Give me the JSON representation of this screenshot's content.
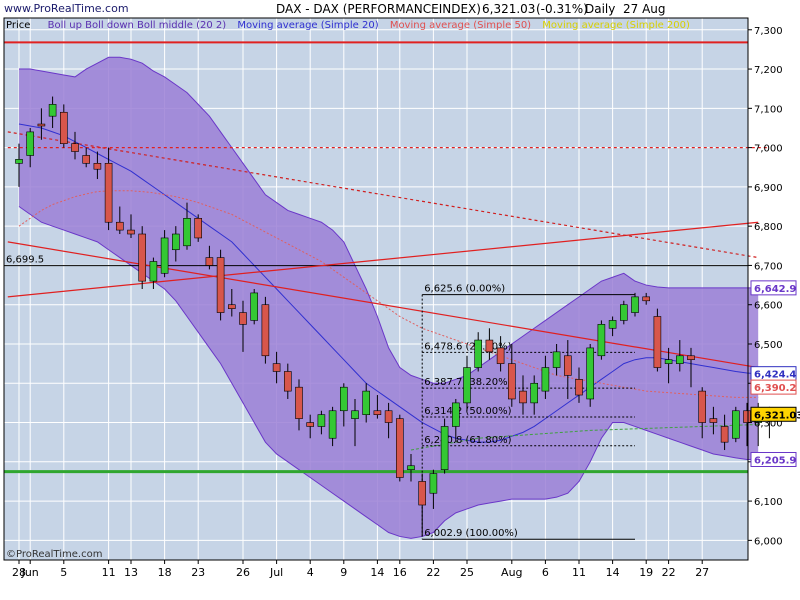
{
  "header": {
    "logo": "www.ProRealTime.com",
    "instrument": "DAX - DAX (PERFORMANCEINDEX)",
    "last": "6,321.03",
    "change": "(-0.31%)",
    "period": "Daily",
    "date": "27 Aug",
    "footer_logo": "©ProRealTime.com"
  },
  "legend": {
    "price": "Price",
    "boll": "Boll up Boll down Boll middle (20 2)",
    "ma20": "Moving average (Simple 20)",
    "ma50": "Moving average (Simple 50)",
    "ma200": "Moving average (Simple 200)"
  },
  "colors": {
    "background": "#c6d4e6",
    "band": "#9b7fd6",
    "band_edge": "#6a37c8",
    "up": "#34c834",
    "down": "#d8564b",
    "red_line": "#e02020",
    "green_line": "#2fa62f"
  },
  "chart_data": {
    "type": "candlestick",
    "ylim": [
      5950,
      7330
    ],
    "yticks": [
      6000,
      6100,
      6200,
      6300,
      6400,
      6500,
      6600,
      6700,
      6800,
      6900,
      7000,
      7100,
      7200,
      7300
    ],
    "ytick_labels": [
      "6,000",
      "6,100",
      "6,200",
      "6,300",
      "6,400",
      "6,500",
      "6,600",
      "6,700",
      "6,800",
      "6,900",
      "7,000",
      "7,100",
      "7,200",
      "7,300"
    ],
    "xticks": [
      {
        "i": 0,
        "label": "28"
      },
      {
        "i": 1,
        "label": "Jun"
      },
      {
        "i": 4,
        "label": "5"
      },
      {
        "i": 8,
        "label": "11"
      },
      {
        "i": 10,
        "label": "13"
      },
      {
        "i": 13,
        "label": "18"
      },
      {
        "i": 16,
        "label": "23"
      },
      {
        "i": 20,
        "label": "26"
      },
      {
        "i": 23,
        "label": "Jul"
      },
      {
        "i": 26,
        "label": "4"
      },
      {
        "i": 29,
        "label": "9"
      },
      {
        "i": 32,
        "label": "14"
      },
      {
        "i": 34,
        "label": "16"
      },
      {
        "i": 37,
        "label": "22"
      },
      {
        "i": 40,
        "label": "25"
      },
      {
        "i": 44,
        "label": "Aug"
      },
      {
        "i": 47,
        "label": "6"
      },
      {
        "i": 50,
        "label": "11"
      },
      {
        "i": 53,
        "label": "14"
      },
      {
        "i": 56,
        "label": "19"
      },
      {
        "i": 58,
        "label": "22"
      },
      {
        "i": 61,
        "label": "27"
      }
    ],
    "candles": [
      {
        "o": 6960,
        "h": 7010,
        "l": 6900,
        "c": 6970
      },
      {
        "o": 6980,
        "h": 7050,
        "l": 6950,
        "c": 7040
      },
      {
        "o": 7060,
        "h": 7100,
        "l": 7020,
        "c": 7055
      },
      {
        "o": 7080,
        "h": 7130,
        "l": 7050,
        "c": 7110
      },
      {
        "o": 7090,
        "h": 7110,
        "l": 7000,
        "c": 7010
      },
      {
        "o": 7010,
        "h": 7040,
        "l": 6970,
        "c": 6990
      },
      {
        "o": 6980,
        "h": 7000,
        "l": 6950,
        "c": 6960
      },
      {
        "o": 6960,
        "h": 6990,
        "l": 6920,
        "c": 6945
      },
      {
        "o": 6960,
        "h": 7000,
        "l": 6790,
        "c": 6810
      },
      {
        "o": 6810,
        "h": 6850,
        "l": 6780,
        "c": 6790
      },
      {
        "o": 6790,
        "h": 6830,
        "l": 6770,
        "c": 6780
      },
      {
        "o": 6780,
        "h": 6800,
        "l": 6640,
        "c": 6660
      },
      {
        "o": 6660,
        "h": 6720,
        "l": 6640,
        "c": 6710
      },
      {
        "o": 6680,
        "h": 6790,
        "l": 6670,
        "c": 6770
      },
      {
        "o": 6740,
        "h": 6800,
        "l": 6710,
        "c": 6780
      },
      {
        "o": 6750,
        "h": 6860,
        "l": 6740,
        "c": 6820
      },
      {
        "o": 6820,
        "h": 6830,
        "l": 6760,
        "c": 6770
      },
      {
        "o": 6720,
        "h": 6750,
        "l": 6690,
        "c": 6700
      },
      {
        "o": 6720,
        "h": 6740,
        "l": 6560,
        "c": 6580
      },
      {
        "o": 6600,
        "h": 6640,
        "l": 6570,
        "c": 6590
      },
      {
        "o": 6580,
        "h": 6610,
        "l": 6480,
        "c": 6550
      },
      {
        "o": 6560,
        "h": 6640,
        "l": 6550,
        "c": 6630
      },
      {
        "o": 6600,
        "h": 6620,
        "l": 6450,
        "c": 6470
      },
      {
        "o": 6450,
        "h": 6480,
        "l": 6400,
        "c": 6430
      },
      {
        "o": 6430,
        "h": 6450,
        "l": 6360,
        "c": 6380
      },
      {
        "o": 6390,
        "h": 6410,
        "l": 6280,
        "c": 6310
      },
      {
        "o": 6300,
        "h": 6320,
        "l": 6260,
        "c": 6290
      },
      {
        "o": 6290,
        "h": 6330,
        "l": 6270,
        "c": 6320
      },
      {
        "o": 6260,
        "h": 6340,
        "l": 6240,
        "c": 6330
      },
      {
        "o": 6330,
        "h": 6400,
        "l": 6290,
        "c": 6390
      },
      {
        "o": 6310,
        "h": 6360,
        "l": 6240,
        "c": 6330
      },
      {
        "o": 6320,
        "h": 6400,
        "l": 6300,
        "c": 6380
      },
      {
        "o": 6330,
        "h": 6370,
        "l": 6310,
        "c": 6320
      },
      {
        "o": 6330,
        "h": 6350,
        "l": 6260,
        "c": 6300
      },
      {
        "o": 6310,
        "h": 6320,
        "l": 6150,
        "c": 6160
      },
      {
        "o": 6180,
        "h": 6220,
        "l": 6150,
        "c": 6190
      },
      {
        "o": 6150,
        "h": 6170,
        "l": 6010,
        "c": 6090
      },
      {
        "o": 6120,
        "h": 6180,
        "l": 6080,
        "c": 6170
      },
      {
        "o": 6180,
        "h": 6310,
        "l": 6170,
        "c": 6290
      },
      {
        "o": 6290,
        "h": 6360,
        "l": 6250,
        "c": 6350
      },
      {
        "o": 6350,
        "h": 6470,
        "l": 6330,
        "c": 6440
      },
      {
        "o": 6440,
        "h": 6530,
        "l": 6430,
        "c": 6510
      },
      {
        "o": 6510,
        "h": 6540,
        "l": 6460,
        "c": 6480
      },
      {
        "o": 6490,
        "h": 6520,
        "l": 6430,
        "c": 6450
      },
      {
        "o": 6450,
        "h": 6500,
        "l": 6340,
        "c": 6360
      },
      {
        "o": 6380,
        "h": 6420,
        "l": 6320,
        "c": 6350
      },
      {
        "o": 6350,
        "h": 6420,
        "l": 6320,
        "c": 6400
      },
      {
        "o": 6380,
        "h": 6470,
        "l": 6360,
        "c": 6440
      },
      {
        "o": 6440,
        "h": 6500,
        "l": 6420,
        "c": 6480
      },
      {
        "o": 6470,
        "h": 6510,
        "l": 6360,
        "c": 6420
      },
      {
        "o": 6410,
        "h": 6440,
        "l": 6350,
        "c": 6370
      },
      {
        "o": 6360,
        "h": 6500,
        "l": 6340,
        "c": 6490
      },
      {
        "o": 6470,
        "h": 6560,
        "l": 6460,
        "c": 6550
      },
      {
        "o": 6540,
        "h": 6570,
        "l": 6520,
        "c": 6560
      },
      {
        "o": 6560,
        "h": 6610,
        "l": 6550,
        "c": 6600
      },
      {
        "o": 6580,
        "h": 6630,
        "l": 6570,
        "c": 6620
      },
      {
        "o": 6620,
        "h": 6630,
        "l": 6600,
        "c": 6610
      },
      {
        "o": 6570,
        "h": 6590,
        "l": 6430,
        "c": 6440
      },
      {
        "o": 6450,
        "h": 6490,
        "l": 6400,
        "c": 6460
      },
      {
        "o": 6450,
        "h": 6510,
        "l": 6430,
        "c": 6470
      },
      {
        "o": 6470,
        "h": 6490,
        "l": 6390,
        "c": 6460
      },
      {
        "o": 6380,
        "h": 6390,
        "l": 6260,
        "c": 6300
      },
      {
        "o": 6310,
        "h": 6340,
        "l": 6270,
        "c": 6300
      },
      {
        "o": 6290,
        "h": 6320,
        "l": 6230,
        "c": 6250
      },
      {
        "o": 6260,
        "h": 6340,
        "l": 6250,
        "c": 6330
      },
      {
        "o": 6330,
        "h": 6350,
        "l": 6240,
        "c": 6300
      },
      {
        "o": 6300,
        "h": 6350,
        "l": 6240,
        "c": 6330
      },
      {
        "o": 6330,
        "h": 6340,
        "l": 6260,
        "c": 6321
      }
    ],
    "boll_upper": [
      7200,
      7200,
      7195,
      7190,
      7185,
      7180,
      7200,
      7215,
      7230,
      7230,
      7225,
      7215,
      7195,
      7180,
      7160,
      7140,
      7110,
      7080,
      7040,
      7000,
      6960,
      6920,
      6880,
      6860,
      6840,
      6830,
      6820,
      6810,
      6790,
      6760,
      6700,
      6640,
      6570,
      6490,
      6440,
      6420,
      6410,
      6400,
      6400,
      6410,
      6420,
      6440,
      6460,
      6480,
      6500,
      6520,
      6540,
      6560,
      6580,
      6600,
      6620,
      6640,
      6660,
      6670,
      6680,
      6660,
      6650,
      6645,
      6643,
      6643,
      6643,
      6643,
      6643,
      6643,
      6643,
      6643,
      6643
    ],
    "boll_lower": [
      6850,
      6830,
      6810,
      6800,
      6790,
      6780,
      6770,
      6760,
      6740,
      6720,
      6700,
      6680,
      6660,
      6640,
      6610,
      6570,
      6530,
      6490,
      6450,
      6400,
      6350,
      6300,
      6250,
      6220,
      6200,
      6180,
      6160,
      6140,
      6120,
      6100,
      6080,
      6060,
      6040,
      6020,
      6010,
      6005,
      6010,
      6020,
      6050,
      6070,
      6080,
      6090,
      6095,
      6100,
      6105,
      6105,
      6105,
      6105,
      6110,
      6120,
      6150,
      6200,
      6260,
      6300,
      6300,
      6290,
      6280,
      6270,
      6260,
      6250,
      6240,
      6230,
      6220,
      6215,
      6210,
      6206,
      6206
    ],
    "ma20": [
      7060,
      7055,
      7050,
      7040,
      7030,
      7015,
      7000,
      6985,
      6970,
      6955,
      6940,
      6920,
      6900,
      6880,
      6860,
      6840,
      6820,
      6800,
      6780,
      6760,
      6730,
      6700,
      6670,
      6640,
      6610,
      6580,
      6550,
      6520,
      6490,
      6460,
      6430,
      6400,
      6380,
      6360,
      6340,
      6320,
      6300,
      6285,
      6270,
      6260,
      6255,
      6250,
      6250,
      6255,
      6265,
      6275,
      6290,
      6310,
      6330,
      6350,
      6370,
      6390,
      6410,
      6430,
      6450,
      6460,
      6465,
      6465,
      6460,
      6455,
      6450,
      6445,
      6440,
      6435,
      6430,
      6426,
      6424
    ],
    "ma50": [
      6800,
      6820,
      6840,
      6855,
      6865,
      6875,
      6882,
      6888,
      6890,
      6890,
      6890,
      6888,
      6885,
      6880,
      6875,
      6868,
      6860,
      6850,
      6840,
      6830,
      6815,
      6800,
      6785,
      6770,
      6755,
      6740,
      6725,
      6710,
      6690,
      6670,
      6650,
      6630,
      6610,
      6590,
      6570,
      6555,
      6540,
      6530,
      6520,
      6510,
      6500,
      6490,
      6480,
      6470,
      6460,
      6450,
      6440,
      6430,
      6420,
      6415,
      6410,
      6405,
      6400,
      6395,
      6390,
      6385,
      6380,
      6378,
      6376,
      6374,
      6372,
      6370,
      6368,
      6366,
      6364,
      6364,
      6364
    ],
    "ma200": [
      6230,
      6235,
      6240,
      6245,
      6250,
      6255,
      6260,
      6262,
      6264,
      6266,
      6268,
      6270,
      6272,
      6274,
      6276,
      6278,
      6280,
      6281,
      6282,
      6283,
      6284,
      6285,
      6286,
      6287,
      6288,
      6289,
      6290,
      6291,
      6292,
      6293,
      6294,
      6295
    ],
    "ma200_start": 35,
    "lines": [
      {
        "name": "resistance",
        "color": "#e02020",
        "style": "solid",
        "from": [
          -1,
          6760
        ],
        "to": [
          66,
          6440
        ]
      },
      {
        "name": "support-rising",
        "color": "#e02020",
        "style": "solid",
        "from": [
          -1,
          6620
        ],
        "to": [
          66,
          6810
        ]
      },
      {
        "name": "down-dashed",
        "color": "#d02020",
        "style": "dashed",
        "from": [
          -1,
          7040
        ],
        "to": [
          66,
          6720
        ]
      },
      {
        "name": "level-7000",
        "color": "#e02020",
        "style": "dashed",
        "from": [
          -1,
          7000
        ],
        "to": [
          67,
          7000
        ]
      }
    ],
    "hlines": [
      {
        "value": 7268,
        "color": "#e02020",
        "width": 2
      },
      {
        "value": 6175,
        "color": "#2fa62f",
        "width": 3
      },
      {
        "value": 6699.5,
        "color": "#000000",
        "width": 1,
        "label": "6,699.5"
      }
    ],
    "fib": {
      "x_start": 36,
      "x_end": 55,
      "levels": [
        {
          "value": 6625.6,
          "label": "6,625.6 (0.00%)"
        },
        {
          "value": 6478.6,
          "label": "6,478.6 (23.60%)"
        },
        {
          "value": 6387.7,
          "label": "6,387.7 (38.20%)"
        },
        {
          "value": 6314.2,
          "label": "6,314.2 (50.00%)"
        },
        {
          "value": 6240.8,
          "label": "6,240.8 (61.80%)"
        },
        {
          "value": 6002.9,
          "label": "6,002.9 (100.00%)"
        }
      ]
    },
    "price_tags": [
      {
        "value": 6642.9,
        "label": "6,642.9",
        "color": "#6a37c8",
        "bg": "#ffffff"
      },
      {
        "value": 6424.4,
        "label": "6,424.4",
        "color": "#3030c0",
        "bg": "#ffffff"
      },
      {
        "value": 6390.2,
        "label": "6,390.2",
        "color": "#e05050",
        "bg": "#ffffff"
      },
      {
        "value": 6321.03,
        "label": "6,321.03",
        "color": "#000000",
        "bg": "#ffd400"
      },
      {
        "value": 6205.9,
        "label": "6,205.9",
        "color": "#6a37c8",
        "bg": "#ffffff"
      }
    ]
  }
}
